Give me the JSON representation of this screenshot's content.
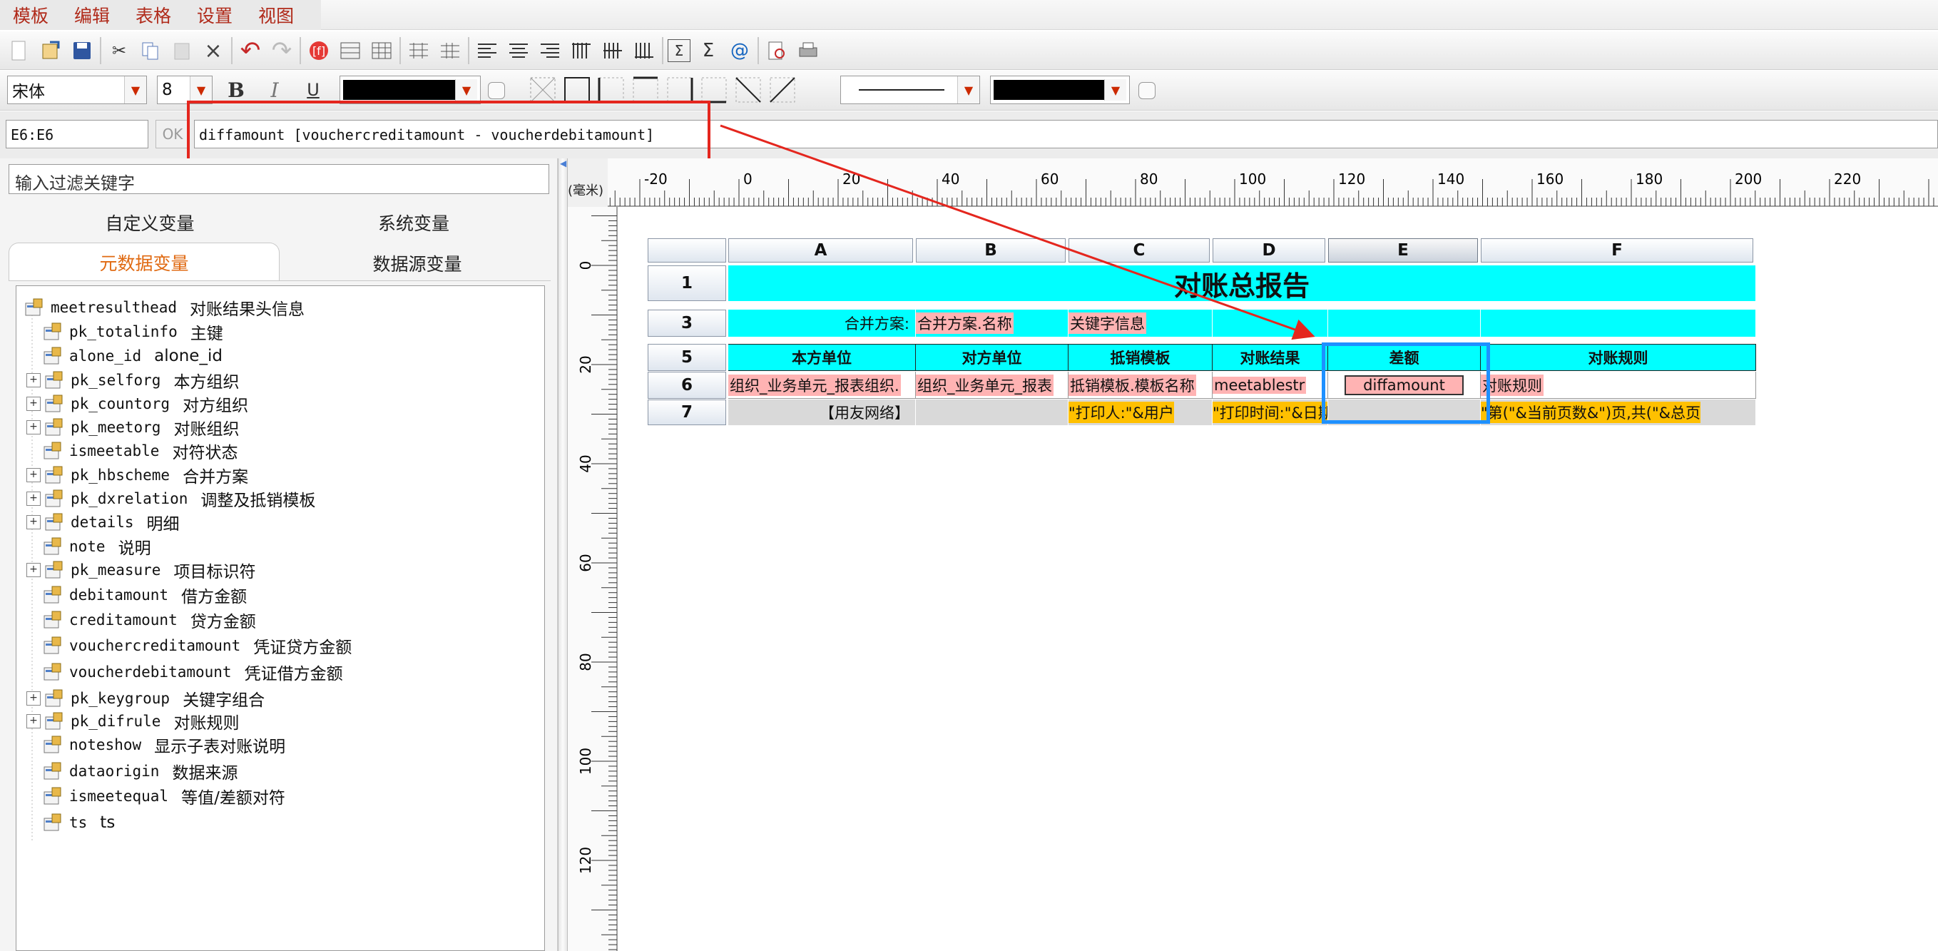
{
  "menu": [
    "模板",
    "编辑",
    "表格",
    "设置",
    "视图"
  ],
  "toolbar2": {
    "font_name": "宋体",
    "font_size": "8",
    "bold_label": "B",
    "italic_label": "I",
    "underline_label": "U",
    "font_color": "#000000",
    "fill_color": "#000000"
  },
  "formula_bar": {
    "cell_ref": "E6:E6",
    "ok_label": "OK",
    "formula": "diffamount  [vouchercreditamount - voucherdebitamount]"
  },
  "left_panel": {
    "filter_placeholder": "输入过滤关键字",
    "tabs_row1": [
      "自定义变量",
      "系统变量"
    ],
    "tabs_row2": [
      "元数据变量",
      "数据源变量"
    ],
    "active_tab": "元数据变量",
    "tree": [
      {
        "code": "meetresulthead",
        "desc": "对账结果头信息",
        "level": 0,
        "expandable": false,
        "root": true
      },
      {
        "code": "pk_totalinfo",
        "desc": "主键",
        "level": 1,
        "expandable": false
      },
      {
        "code": "alone_id",
        "desc": "alone_id",
        "level": 1,
        "expandable": false
      },
      {
        "code": "pk_selforg",
        "desc": "本方组织",
        "level": 1,
        "expandable": true
      },
      {
        "code": "pk_countorg",
        "desc": "对方组织",
        "level": 1,
        "expandable": true
      },
      {
        "code": "pk_meetorg",
        "desc": "对账组织",
        "level": 1,
        "expandable": true
      },
      {
        "code": "ismeetable",
        "desc": "对符状态",
        "level": 1,
        "expandable": false
      },
      {
        "code": "pk_hbscheme",
        "desc": "合并方案",
        "level": 1,
        "expandable": true
      },
      {
        "code": "pk_dxrelation",
        "desc": "调整及抵销模板",
        "level": 1,
        "expandable": true
      },
      {
        "code": "details",
        "desc": "明细",
        "level": 1,
        "expandable": true
      },
      {
        "code": "note",
        "desc": "说明",
        "level": 1,
        "expandable": false
      },
      {
        "code": "pk_measure",
        "desc": "项目标识符",
        "level": 1,
        "expandable": true
      },
      {
        "code": "debitamount",
        "desc": "借方金额",
        "level": 1,
        "expandable": false
      },
      {
        "code": "creditamount",
        "desc": "贷方金额",
        "level": 1,
        "expandable": false
      },
      {
        "code": "vouchercreditamount",
        "desc": "凭证贷方金额",
        "level": 1,
        "expandable": false
      },
      {
        "code": "voucherdebitamount",
        "desc": "凭证借方金额",
        "level": 1,
        "expandable": false
      },
      {
        "code": "pk_keygroup",
        "desc": "关键字组合",
        "level": 1,
        "expandable": true
      },
      {
        "code": "pk_difrule",
        "desc": "对账规则",
        "level": 1,
        "expandable": true
      },
      {
        "code": "noteshow",
        "desc": "显示子表对账说明",
        "level": 1,
        "expandable": false
      },
      {
        "code": "dataorigin",
        "desc": "数据来源",
        "level": 1,
        "expandable": false
      },
      {
        "code": "ismeetequal",
        "desc": "等值/差额对符",
        "level": 1,
        "expandable": false
      },
      {
        "code": "ts",
        "desc": "ts",
        "level": 1,
        "expandable": false
      }
    ]
  },
  "ruler": {
    "unit_label": "(毫米)",
    "h_labels": [
      "-20",
      "0",
      "20",
      "40",
      "60",
      "80",
      "100",
      "120",
      "140",
      "160",
      "180",
      "200",
      "220"
    ],
    "v_labels": [
      "0",
      "20",
      "40",
      "60",
      "80",
      "100",
      "120"
    ]
  },
  "sheet": {
    "columns": [
      "A",
      "B",
      "C",
      "D",
      "E",
      "F"
    ],
    "selected_column": "E",
    "rows": [
      {
        "num": "1",
        "cells": [
          {
            "text": "对账总报告",
            "span": 6,
            "style": "title"
          }
        ]
      },
      {
        "num": "3",
        "cells": [
          {
            "text": "合并方案:",
            "style": "cyan-right"
          },
          {
            "text": "合并方案.名称",
            "style": "cyan-pink"
          },
          {
            "text": "关键字信息",
            "style": "cyan-pink"
          },
          {
            "text": "",
            "style": "cyan"
          },
          {
            "text": "",
            "style": "cyan"
          },
          {
            "text": "",
            "style": "cyan"
          }
        ]
      },
      {
        "num": "5",
        "cells": [
          {
            "text": "本方单位",
            "style": "cyan-bold"
          },
          {
            "text": "对方单位",
            "style": "cyan-bold"
          },
          {
            "text": "抵销模板",
            "style": "cyan-bold"
          },
          {
            "text": "对账结果",
            "style": "cyan-bold"
          },
          {
            "text": "差额",
            "style": "cyan-bold"
          },
          {
            "text": "对账规则",
            "style": "cyan-bold"
          }
        ]
      },
      {
        "num": "6",
        "cells": [
          {
            "text": "组织_业务单元_报表组织.",
            "style": "white-pink"
          },
          {
            "text": "组织_业务单元_报表",
            "style": "white-pink"
          },
          {
            "text": "抵销模板.模板名称",
            "style": "white-pink"
          },
          {
            "text": "meetablestr",
            "style": "white-pink"
          },
          {
            "text": "diffamount",
            "style": "white-pink-center"
          },
          {
            "text": "对账规则",
            "style": "white-pink"
          }
        ]
      },
      {
        "num": "7",
        "cells": [
          {
            "text": "【用友网络】",
            "style": "gray-right"
          },
          {
            "text": "",
            "style": "gray"
          },
          {
            "text": "\"打印人:\"&用户",
            "style": "gray-yellow"
          },
          {
            "text": "\"打印时间:\"&日期",
            "style": "gray-yellow"
          },
          {
            "text": "",
            "style": "gray"
          },
          {
            "text": "\"第(\"&当前页数&\")页,共(\"&总页",
            "style": "gray-yellow"
          }
        ]
      }
    ]
  },
  "annotation_color": "#e4261e",
  "selection_color": "#1e90ff"
}
